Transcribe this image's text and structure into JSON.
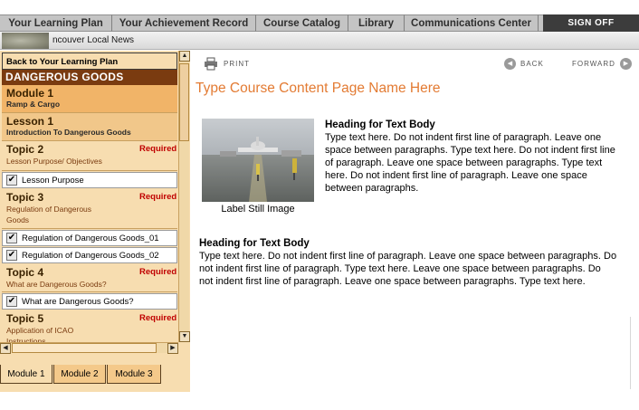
{
  "topnav": {
    "tabs": [
      "Your Learning Plan",
      "Your Achievement Record",
      "Course Catalog",
      "Library",
      "Communications Center"
    ],
    "sign_off": "SIGN OFF"
  },
  "newsbar": {
    "label": "ncouver Local News"
  },
  "sidebar": {
    "back": "Back to Your Learning Plan",
    "course": "DANGEROUS GOODS",
    "module": {
      "title": "Module 1",
      "subtitle": "Ramp & Cargo"
    },
    "lesson": {
      "title": "Lesson 1",
      "subtitle": "Introduction To Dangerous Goods"
    },
    "required_label": "Required",
    "topics": [
      {
        "title": "Topic 2",
        "subtitle": "Lesson Purpose/ Objectives",
        "items": [
          "Lesson Purpose"
        ]
      },
      {
        "title": "Topic 3",
        "subtitle": "Regulation of Dangerous Goods",
        "items": [
          "Regulation of Dangerous Goods_01",
          "Regulation of Dangerous Goods_02"
        ]
      },
      {
        "title": "Topic 4",
        "subtitle": "What are Dangerous Goods?",
        "items": [
          "What are Dangerous Goods?"
        ]
      },
      {
        "title": "Topic 5",
        "subtitle": "Application of ICAO Instructions",
        "items": []
      }
    ],
    "module_tabs": [
      "Module 1",
      "Module 2",
      "Module 3"
    ]
  },
  "toolbar": {
    "print": "PRINT",
    "back": "BACK",
    "forward": "FORWARD"
  },
  "main": {
    "page_title": "Type Course Content Page Name Here",
    "image_label": "Label Still Image",
    "sections": [
      {
        "heading": "Heading for Text Body",
        "text": "Type text here. Do not indent first line of paragraph. Leave one space between paragraphs. Type text here. Do not indent first line of paragraph. Leave one space between paragraphs. Type text here. Do not indent first line of paragraph. Leave one space between paragraphs."
      },
      {
        "heading": "Heading for Text Body",
        "text": "Type text here. Do not indent first line of paragraph. Leave one space between paragraphs. Do not indent first line of paragraph. Type text here. Leave one space between paragraphs. Do not indent first line of paragraph. Leave one space between paragraphs. Type text here."
      }
    ]
  },
  "colors": {
    "accent_title": "#e37b33",
    "course_banner": "#7a3b10",
    "required": "#c00000",
    "sidebar_bg": "#f7ddb0"
  }
}
